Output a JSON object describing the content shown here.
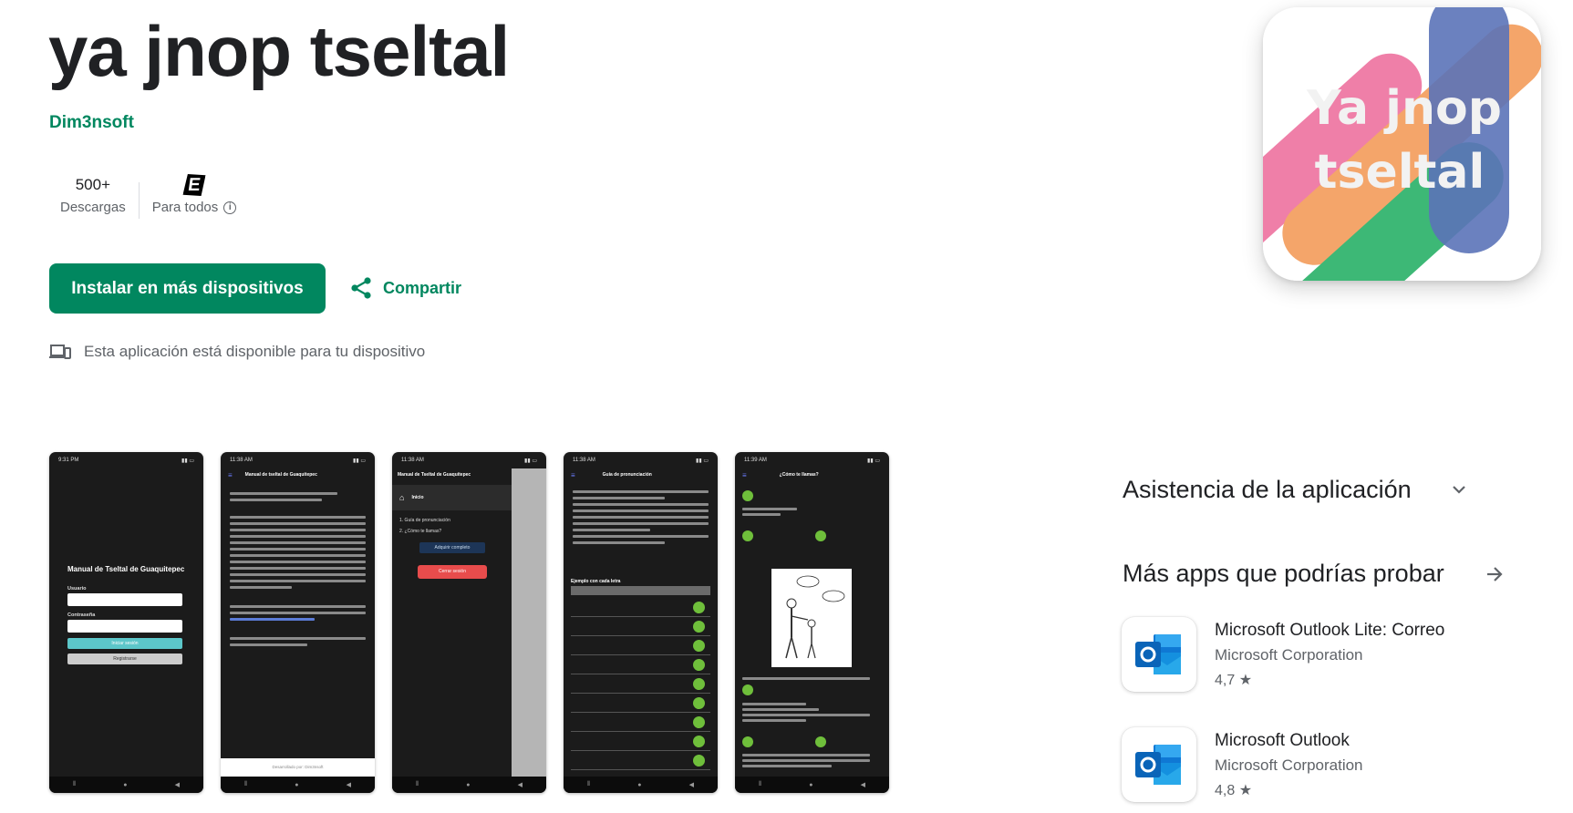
{
  "app": {
    "title": "ya jnop tseltal",
    "developer": "Dim3nsoft",
    "downloads_value": "500+",
    "downloads_label": "Descargas",
    "rating_badge": "E",
    "rating_label": "Para todos",
    "install_label": "Instalar en más dispositivos",
    "share_label": "Compartir",
    "device_note": "Esta aplicación está disponible para tu dispositivo",
    "icon_text_line1": "Ya jnop",
    "icon_text_line2": "tseltal"
  },
  "screenshots": {
    "s1": {
      "time": "9:31 PM",
      "title": "Manual de Tseltal de Guaquitepec",
      "user_label": "Usuario",
      "pass_label": "Contraseña",
      "login_btn": "Iniciar sesión",
      "register_btn": "Registrarse"
    },
    "s2": {
      "time": "11:38 AM",
      "title": "Manual de tseltal de Guaquitepec",
      "footer": "Desarrollado por: Dim3nsoft"
    },
    "s3": {
      "time": "11:38 AM",
      "title": "Manual de Tseltal de Guaquitepec",
      "menu_home": "Inicio",
      "menu_1": "1. Guía de pronunciación",
      "menu_2": "2. ¿Cómo te llamas?",
      "buy_btn": "Adquirir completo",
      "logout_btn": "Cerrar sesión"
    },
    "s4": {
      "time": "11:38 AM",
      "title": "Guía de pronunciación",
      "table_title": "Ejemplo con cada letra"
    },
    "s5": {
      "time": "11:39 AM",
      "title": "¿Cómo te llamas?"
    }
  },
  "sidebar": {
    "support_title": "Asistencia de la aplicación",
    "more_apps_title": "Más apps que podrías probar",
    "recommendations": [
      {
        "name": "Microsoft Outlook Lite: Correo",
        "developer": "Microsoft Corporation",
        "rating": "4,7 ★"
      },
      {
        "name": "Microsoft Outlook",
        "developer": "Microsoft Corporation",
        "rating": "4,8 ★"
      }
    ]
  },
  "colors": {
    "accent": "#01875f",
    "text": "#202124",
    "muted": "#5f6368"
  }
}
